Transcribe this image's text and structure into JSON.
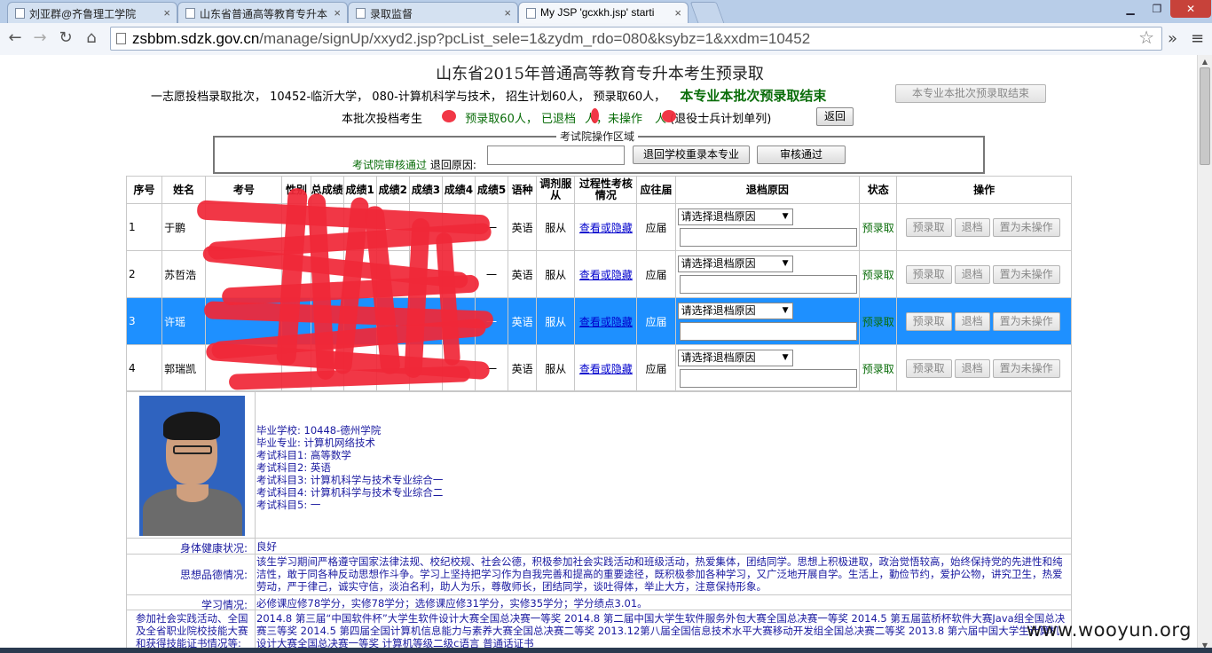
{
  "browser": {
    "tabs": [
      {
        "label": "刘亚群@齐鲁理工学院",
        "active": false
      },
      {
        "label": "山东省普通高等教育专升本",
        "active": false
      },
      {
        "label": "录取监督",
        "active": false
      },
      {
        "label": "My JSP 'gcxkh.jsp' starti",
        "active": true
      }
    ],
    "url_domain": "zsbbm.sdzk.gov.cn",
    "url_path": "/manage/signUp/xxyd2.jsp?pcList_sele=1&zydm_rdo=080&ksybz=1&xxdm=10452"
  },
  "page": {
    "title": "山东省2015年普通高等教育专升本考生预录取",
    "info_line": "一志愿投档录取批次， 10452-临沂大学， 080-计算机科学与技术， 招生计划60人， 预录取60人，",
    "info_status": "本专业本批次预录取结束",
    "finish_button": "本专业本批次预录取结束",
    "stat_prefix": "本批次投档考生",
    "stat_green": "预录取60人， 已退档",
    "stat_mid": "人，未操作",
    "stat_suffix": "人",
    "stat_note": "(退役士兵计划单列)",
    "back_button": "返回",
    "area": {
      "legend": "考试院操作区域",
      "audit_label": "考试院审核通过",
      "reason_label": "退回原因:",
      "reason_value": "",
      "return_button": "退回学校重录本专业",
      "approve_button": "审核通过"
    },
    "table": {
      "headers": [
        "序号",
        "姓名",
        "考号",
        "性别",
        "总成绩",
        "成绩1",
        "成绩2",
        "成绩3",
        "成绩4",
        "成绩5",
        "语种",
        "调剂服从",
        "过程性考核情况",
        "应往届",
        "退档原因",
        "状态",
        "操作"
      ],
      "rows": [
        {
          "no": "1",
          "name": "于鹏",
          "language": "英语",
          "obey": "服从",
          "link": "查看或隐藏",
          "grad": "应届",
          "reason": "请选择退档原因",
          "status": "预录取",
          "score5": "一"
        },
        {
          "no": "2",
          "name": "苏哲浩",
          "language": "英语",
          "obey": "服从",
          "link": "查看或隐藏",
          "grad": "应届",
          "reason": "请选择退档原因",
          "status": "预录取",
          "score5": "一"
        },
        {
          "no": "3",
          "name": "许瑶",
          "language": "英语",
          "obey": "服从",
          "link": "查看或隐藏",
          "grad": "应届",
          "reason": "请选择退档原因",
          "status": "预录取",
          "score5": "一"
        },
        {
          "no": "4",
          "name": "郭瑞凯",
          "language": "英语",
          "obey": "服从",
          "link": "查看或隐藏",
          "grad": "应届",
          "reason": "请选择退档原因",
          "status": "预录取",
          "score5": "一"
        }
      ],
      "op_buttons": [
        "预录取",
        "退档",
        "置为未操作"
      ]
    },
    "detail": {
      "school": "毕业学校: 10448-德州学院",
      "major": "毕业专业: 计算机网络技术",
      "subject1": "考试科目1: 高等数学",
      "subject2": "考试科目2: 英语",
      "subject3": "考试科目3: 计算机科学与技术专业综合一",
      "subject4": "考试科目4: 计算机科学与技术专业综合二",
      "subject5": "考试科目5: 一",
      "health_label": "身体健康状况:",
      "health_value": "良好",
      "moral_label": "思想品德情况:",
      "moral_value": "该生学习期间严格遵守国家法律法规、校纪校规、社会公德，积极参加社会实践活动和班级活动，热爱集体，团结同学。思想上积极进取，政治觉悟较高，始终保持党的先进性和纯洁性，敢于同各种反动思想作斗争。学习上坚持把学习作为自我完善和提高的重要途径，既积极参加各种学习，又广泛地开展自学。生活上，勤俭节约，爱护公物，讲究卫生，热爱劳动，严于律己，诚实守信，淡泊名利，助人为乐，尊敬师长，团结同学，谈吐得体，举止大方，注意保持形象。",
      "study_label": "学习情况:",
      "study_value": "必修课应修78学分，实修78学分；选修课应修31学分，实修35学分；学分绩点3.01。",
      "award_label": "参加社会实践活动、全国及全省职业院校技能大赛和获得技能证书情况等:",
      "award_value": "2014.8 第三届“中国软件杯”大学生软件设计大赛全国总决赛一等奖 2014.8 第二届中国大学生软件服务外包大赛全国总决赛一等奖 2014.5 第五届蓝桥杯软件大赛Java组全国总决赛三等奖 2014.5 第四届全国计算机信息能力与素养大赛全国总决赛二等奖 2013.12第八届全国信息技术水平大赛移动开发组全国总决赛二等奖 2013.8 第六届中国大学生计算机设计大赛全国总决赛一等奖 计算机等级二级c语言 普通话证书"
    },
    "watermark": "www.wooyun.org"
  },
  "colors": {
    "accent_blue": "#1e90ff",
    "status_green": "#0a6d0a",
    "redaction": "#f02838"
  }
}
